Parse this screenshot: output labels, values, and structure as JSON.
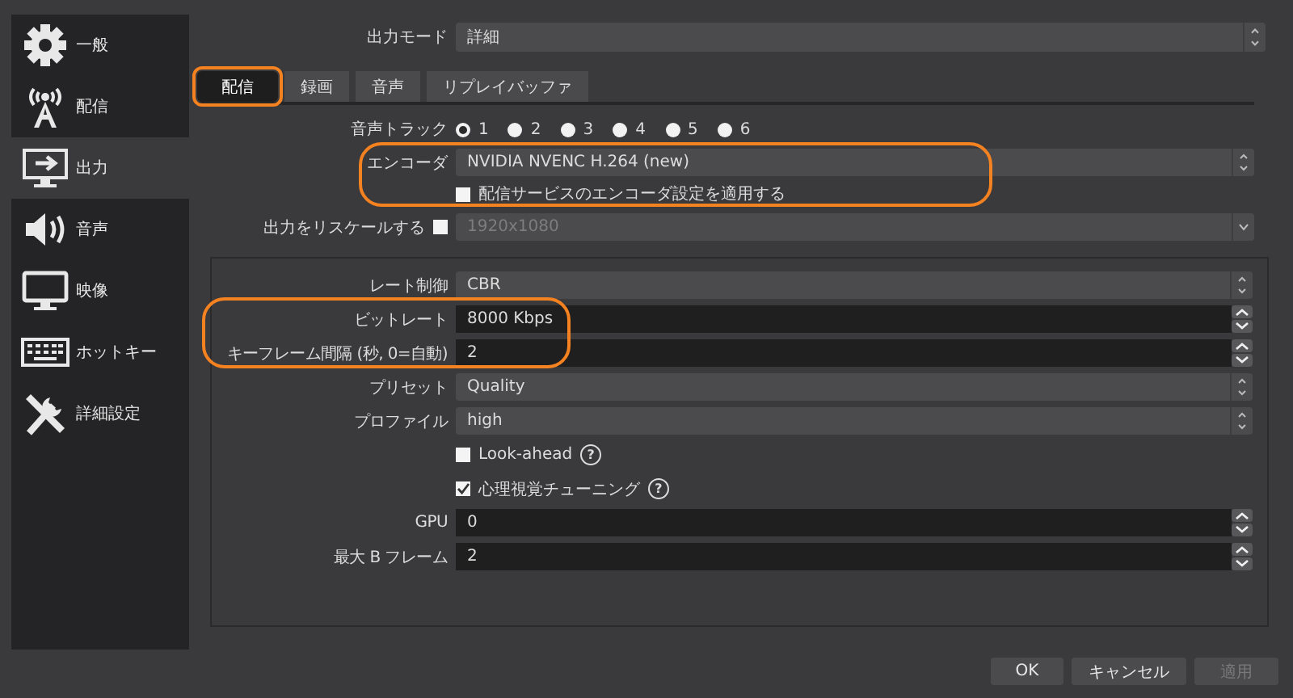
{
  "sidebar": {
    "items": [
      {
        "label": "一般",
        "selected": false
      },
      {
        "label": "配信",
        "selected": false
      },
      {
        "label": "出力",
        "selected": true
      },
      {
        "label": "音声",
        "selected": false
      },
      {
        "label": "映像",
        "selected": false
      },
      {
        "label": "ホットキー",
        "selected": false
      },
      {
        "label": "詳細設定",
        "selected": false
      }
    ]
  },
  "output_mode": {
    "label": "出力モード",
    "value": "詳細"
  },
  "tabs": [
    {
      "label": "配信",
      "selected": true,
      "highlighted": true
    },
    {
      "label": "録画",
      "selected": false,
      "highlighted": false
    },
    {
      "label": "音声",
      "selected": false,
      "highlighted": false
    },
    {
      "label": "リプレイバッファ",
      "selected": false,
      "highlighted": false
    }
  ],
  "stream_settings": [
    {
      "kind": "radios",
      "label": "音声トラック",
      "options": [
        {
          "label": "1",
          "selected": true
        },
        {
          "label": "2",
          "selected": false
        },
        {
          "label": "3",
          "selected": false
        },
        {
          "label": "4",
          "selected": false
        },
        {
          "label": "5",
          "selected": false
        },
        {
          "label": "6",
          "selected": false
        }
      ]
    },
    {
      "kind": "combo",
      "label": "エンコーダ",
      "value": "NVIDIA NVENC H.264 (new)",
      "highlighted": true
    },
    {
      "kind": "checkbox",
      "label": "配信サービスのエンコーダ設定を適用する",
      "checked": false,
      "highlighted": true
    },
    {
      "kind": "rescale",
      "label": "出力をリスケールする",
      "checked": false,
      "value": "1920x1080",
      "disabled": true
    }
  ],
  "encoder_settings": [
    {
      "kind": "combo",
      "label": "レート制御",
      "value": "CBR"
    },
    {
      "kind": "spin",
      "label": "ビットレート",
      "value": "8000 Kbps",
      "highlighted": true
    },
    {
      "kind": "spin",
      "label": "キーフレーム間隔 (秒, 0=自動)",
      "value": "2",
      "highlighted": true
    },
    {
      "kind": "combo",
      "label": "プリセット",
      "value": "Quality"
    },
    {
      "kind": "combo",
      "label": "プロファイル",
      "value": "high"
    },
    {
      "kind": "checkbox",
      "label": "Look-ahead",
      "checked": false,
      "help": "?"
    },
    {
      "kind": "checkbox",
      "label": "心理視覚チューニング",
      "checked": true,
      "help": "?"
    },
    {
      "kind": "spin",
      "label": "GPU",
      "value": "0"
    },
    {
      "kind": "spin",
      "label": "最大 B フレーム",
      "value": "2"
    }
  ],
  "buttons": [
    {
      "label": "OK",
      "disabled": false
    },
    {
      "label": "キャンセル",
      "disabled": false
    },
    {
      "label": "適用",
      "disabled": true
    }
  ]
}
